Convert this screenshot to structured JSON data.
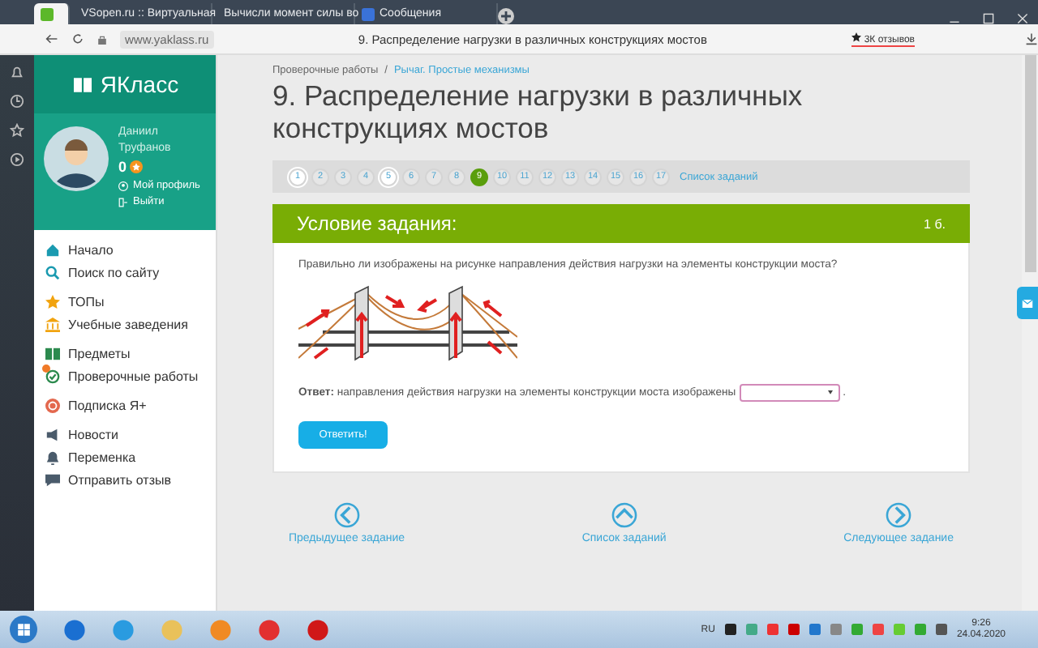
{
  "browser": {
    "tabs": [
      {
        "selected": true
      },
      {
        "label": "VSopen.ru :: Виртуальная",
        "selected": false
      },
      {
        "label": "Вычисли момент силы во",
        "selected": false
      },
      {
        "label": "Сообщения",
        "selected": false
      }
    ],
    "address": {
      "url": "www.yaklass.ru",
      "page_title": "9. Распределение нагрузки в различных конструкциях мостов",
      "reviews": "3К отзывов"
    }
  },
  "sidebar": {
    "logo": "ЯКласс",
    "user": {
      "first_name": "Даниил",
      "last_name": "Труфанов",
      "points": "0"
    },
    "profile_links": [
      {
        "kind": "profile",
        "label": "Мой профиль"
      },
      {
        "kind": "logout",
        "label": "Выйти"
      }
    ],
    "menu_groups": [
      [
        {
          "kind": "home",
          "label": "Начало"
        },
        {
          "kind": "search",
          "label": "Поиск по сайту"
        }
      ],
      [
        {
          "kind": "star",
          "label": "ТОПы"
        },
        {
          "kind": "school",
          "label": "Учебные заведения"
        }
      ],
      [
        {
          "kind": "books",
          "label": "Предметы"
        },
        {
          "kind": "check",
          "label": "Проверочные работы",
          "badge": true
        }
      ],
      [
        {
          "kind": "plus",
          "label": "Подписка Я+"
        }
      ],
      [
        {
          "kind": "news",
          "label": "Новости"
        },
        {
          "kind": "bell",
          "label": "Переменка"
        },
        {
          "kind": "chat",
          "label": "Отправить отзыв"
        }
      ]
    ]
  },
  "main": {
    "breadcrumb": [
      "Проверочные работы",
      "Рычаг. Простые механизмы"
    ],
    "breadcrumb_separator": "/",
    "title": "9. Распределение нагрузки в различных конструкциях мостов",
    "pages": [
      {
        "label": "1",
        "selected": false,
        "visited": true
      },
      {
        "label": "2",
        "selected": false,
        "visited": false
      },
      {
        "label": "3",
        "selected": false,
        "visited": false
      },
      {
        "label": "4",
        "selected": false,
        "visited": false
      },
      {
        "label": "5",
        "selected": false,
        "visited": true
      },
      {
        "label": "6",
        "selected": false,
        "visited": false
      },
      {
        "label": "7",
        "selected": false,
        "visited": false
      },
      {
        "label": "8",
        "selected": false,
        "visited": false
      },
      {
        "label": "9",
        "selected": true,
        "visited": false
      },
      {
        "label": "10",
        "selected": false,
        "visited": false
      },
      {
        "label": "11",
        "selected": false,
        "visited": false
      },
      {
        "label": "12",
        "selected": false,
        "visited": false
      },
      {
        "label": "13",
        "selected": false,
        "visited": false
      },
      {
        "label": "14",
        "selected": false,
        "visited": false
      },
      {
        "label": "15",
        "selected": false,
        "visited": false
      },
      {
        "label": "16",
        "selected": false,
        "visited": false
      },
      {
        "label": "17",
        "selected": false,
        "visited": false
      }
    ],
    "task_list_link": "Список заданий",
    "task": {
      "header": "Условие задания:",
      "points": "1 б.",
      "question": "Правильно ли изображены на рисунке направления действия нагрузки на элементы конструкции моста?",
      "answer": "**Ответ:** направления действия нагрузки на элементы конструкции моста изображены",
      "answer_end": ".",
      "submit": "Ответить!"
    },
    "nav": [
      {
        "kind": "prev",
        "label": "Предыдущее задание"
      },
      {
        "kind": "list",
        "label": "Список заданий"
      },
      {
        "kind": "next",
        "label": "Следующее задание"
      }
    ]
  },
  "taskbar": {
    "language": "RU",
    "time": "9:26",
    "date": "24.04.2020"
  }
}
